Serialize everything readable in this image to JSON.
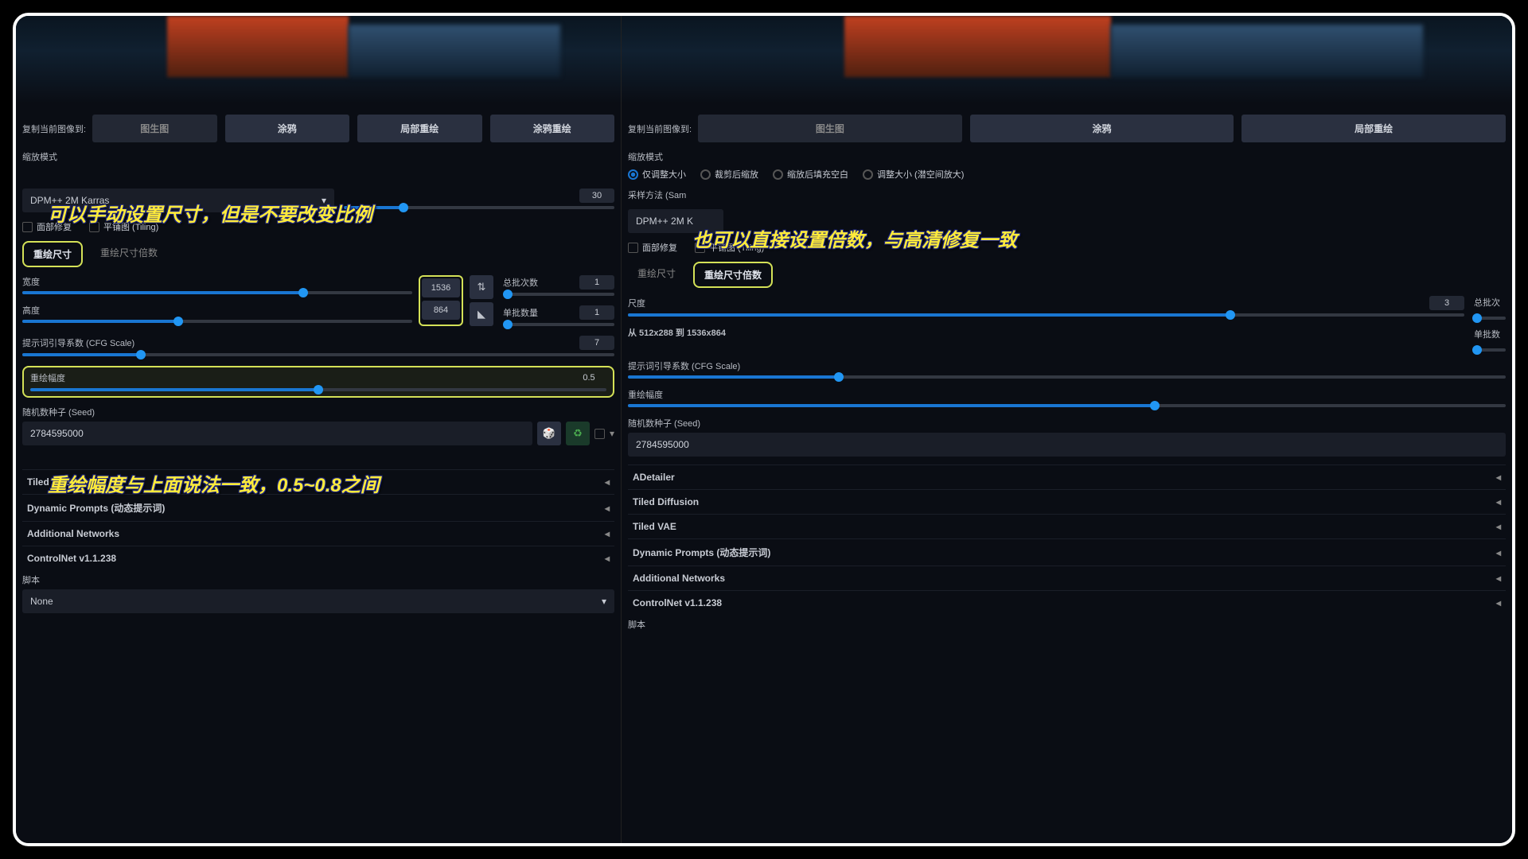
{
  "annotations": {
    "a1": "可以手动设置尺寸，但是不要改变比例",
    "a2": "重绘幅度与上面说法一致，0.5~0.8之间",
    "a3": "也可以直接设置倍数，与高清修复一致"
  },
  "copy_label": "复制当前图像到:",
  "copy_buttons": {
    "img2img": "图生图",
    "sketch": "涂鸦",
    "inpaint": "局部重绘",
    "inpaint_sketch": "涂鸦重绘"
  },
  "resize_mode_label": "缩放模式",
  "resize_modes": {
    "just": "仅调整大小",
    "crop": "裁剪后缩放",
    "fill": "缩放后填充空白",
    "latent": "调整大小 (潜空间放大)"
  },
  "sampler_label_partial": "采样方法 (Sam",
  "sampler_value": "DPM++ 2M Karras",
  "sampler_value_short": "DPM++ 2M K",
  "steps_value": "30",
  "face_restore": "面部修复",
  "tiling": "平铺图 (Tiling)",
  "tabs": {
    "resize_to": "重绘尺寸",
    "resize_by": "重绘尺寸倍数"
  },
  "dims": {
    "width_label": "宽度",
    "height_label": "高度",
    "width": "1536",
    "height": "864"
  },
  "scale": {
    "label": "尺度",
    "value": "3",
    "range_text": "从 512x288 到 1536x864"
  },
  "batch": {
    "count_label": "总批次数",
    "count_val": "1",
    "size_label": "单批数量",
    "size_val": "1",
    "count_label_short": "总批次",
    "size_label_short": "单批数"
  },
  "cfg": {
    "label": "提示词引导系数 (CFG Scale)",
    "value": "7"
  },
  "denoise": {
    "label": "重绘幅度",
    "value": "0.5"
  },
  "seed": {
    "label": "随机数种子 (Seed)",
    "value": "2784595000"
  },
  "accordions": [
    "ADetailer",
    "Tiled Diffusion",
    "Tiled VAE",
    "Dynamic Prompts (动态提示词)",
    "Additional Networks",
    "ControlNet v1.1.238"
  ],
  "left_accordions": [
    "Tiled VAE",
    "Dynamic Prompts (动态提示词)",
    "Additional Networks",
    "ControlNet v1.1.238"
  ],
  "script_label": "脚本",
  "script_value": "None"
}
